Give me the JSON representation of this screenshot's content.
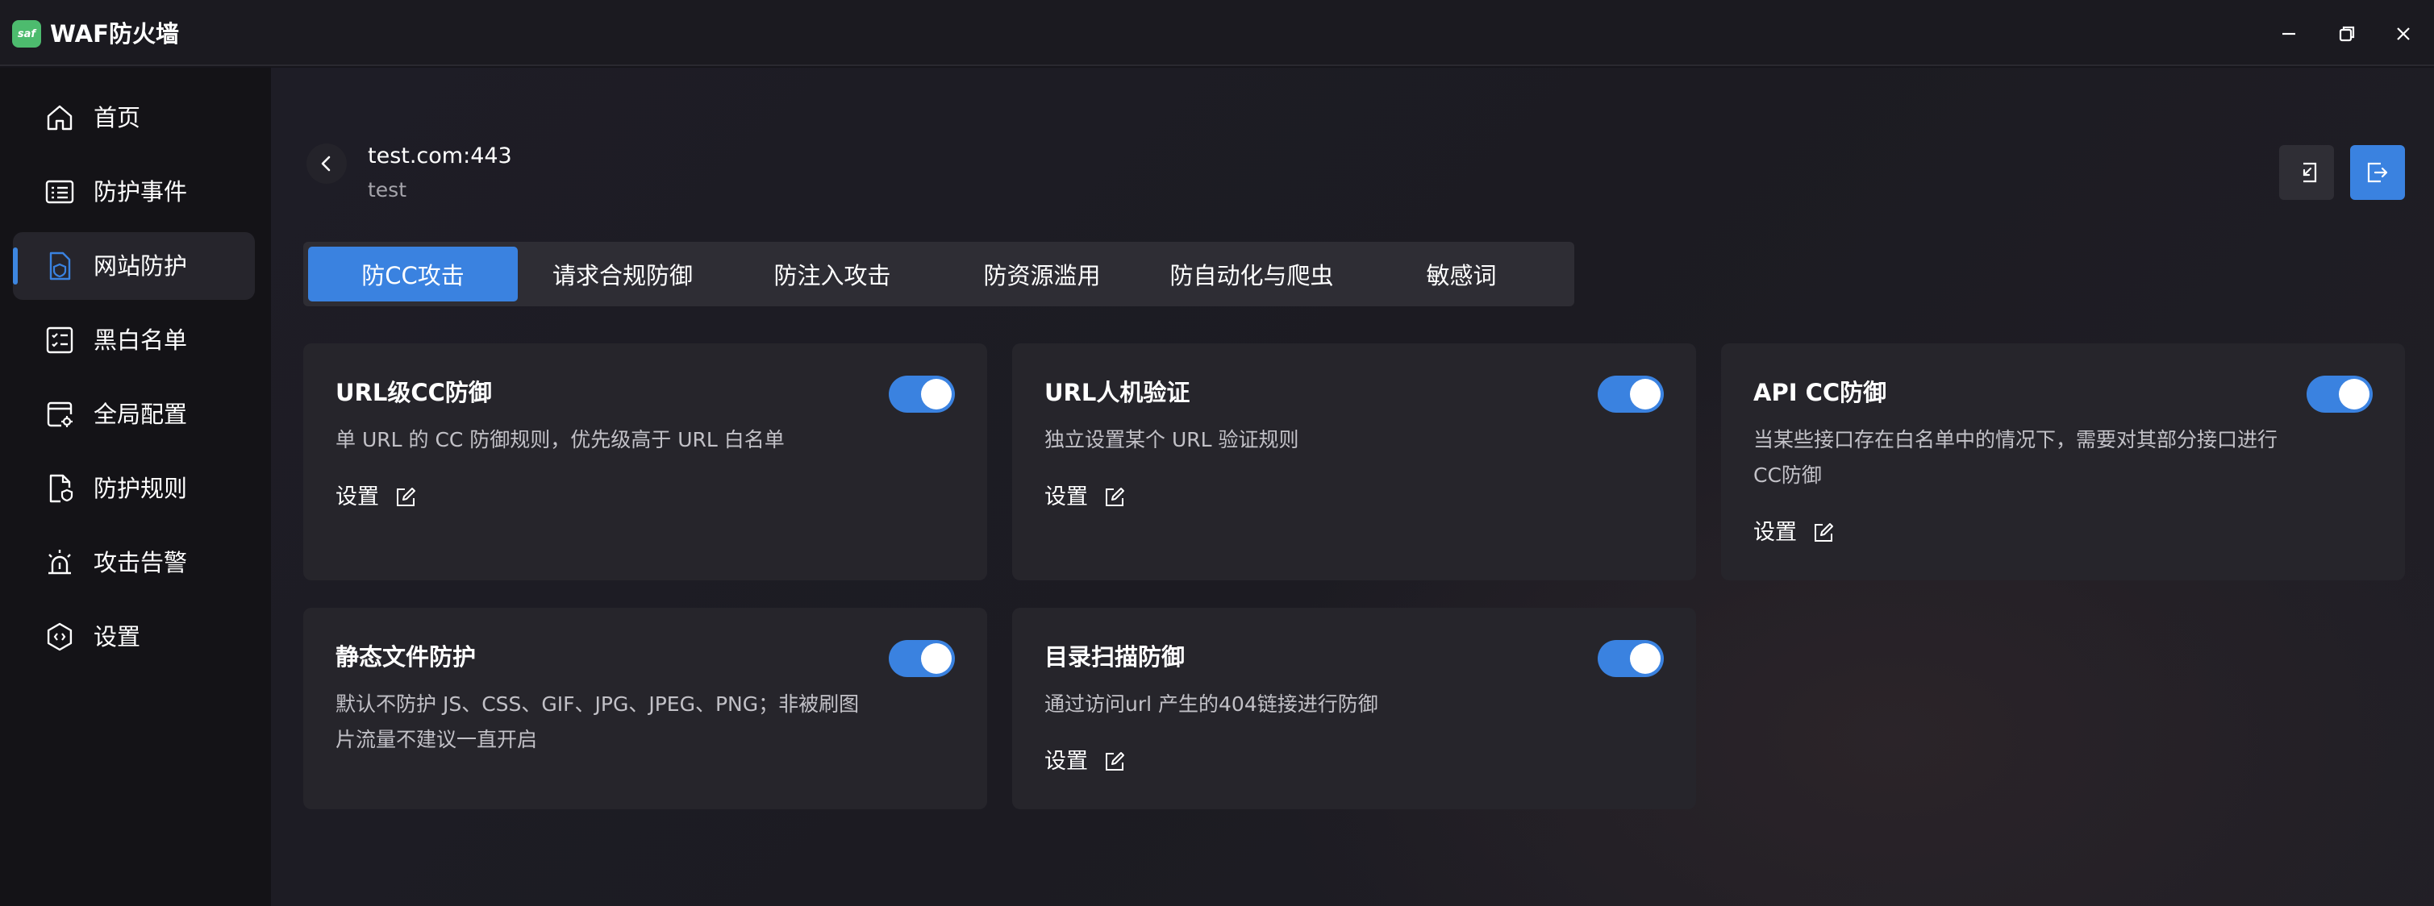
{
  "app": {
    "title": "WAF防火墙",
    "logo_text": "saf",
    "accent_color": "#3a82e0"
  },
  "window_controls": {
    "minimize_icon": "minimize-icon",
    "restore_icon": "restore-icon",
    "close_icon": "close-icon"
  },
  "sidebar": {
    "items": [
      {
        "label": "首页",
        "icon": "home-icon",
        "active": false
      },
      {
        "label": "防护事件",
        "icon": "list-icon",
        "active": false
      },
      {
        "label": "网站防护",
        "icon": "site-shield-icon",
        "active": true
      },
      {
        "label": "黑白名单",
        "icon": "checklist-icon",
        "active": false
      },
      {
        "label": "全局配置",
        "icon": "global-config-icon",
        "active": false
      },
      {
        "label": "防护规则",
        "icon": "rule-doc-icon",
        "active": false
      },
      {
        "label": "攻击告警",
        "icon": "alarm-icon",
        "active": false
      },
      {
        "label": "设置",
        "icon": "gear-icon",
        "active": false
      }
    ]
  },
  "site": {
    "host": "test.com:443",
    "name": "test"
  },
  "tabs": [
    {
      "label": "防CC攻击",
      "active": true
    },
    {
      "label": "请求合规防御",
      "active": false
    },
    {
      "label": "防注入攻击",
      "active": false
    },
    {
      "label": "防资源滥用",
      "active": false
    },
    {
      "label": "防自动化与爬虫",
      "active": false
    },
    {
      "label": "敏感词",
      "active": false
    }
  ],
  "cards": [
    {
      "title": "URL级CC防御",
      "desc": "单 URL 的 CC 防御规则，优先级高于 URL 白名单",
      "setting_label": "设置",
      "enabled": true
    },
    {
      "title": "URL人机验证",
      "desc": "独立设置某个 URL 验证规则",
      "setting_label": "设置",
      "enabled": true
    },
    {
      "title": "API CC防御",
      "desc": "当某些接口存在白名单中的情况下，需要对其部分接口进行CC防御",
      "setting_label": "设置",
      "enabled": true
    },
    {
      "title": "静态文件防护",
      "desc": "默认不防护 JS、CSS、GIF、JPG、JPEG、PNG；非被刷图片流量不建议一直开启",
      "setting_label": "设置",
      "enabled": true
    },
    {
      "title": "目录扫描防御",
      "desc": "通过访问url 产生的404链接进行防御",
      "setting_label": "设置",
      "enabled": true
    }
  ]
}
